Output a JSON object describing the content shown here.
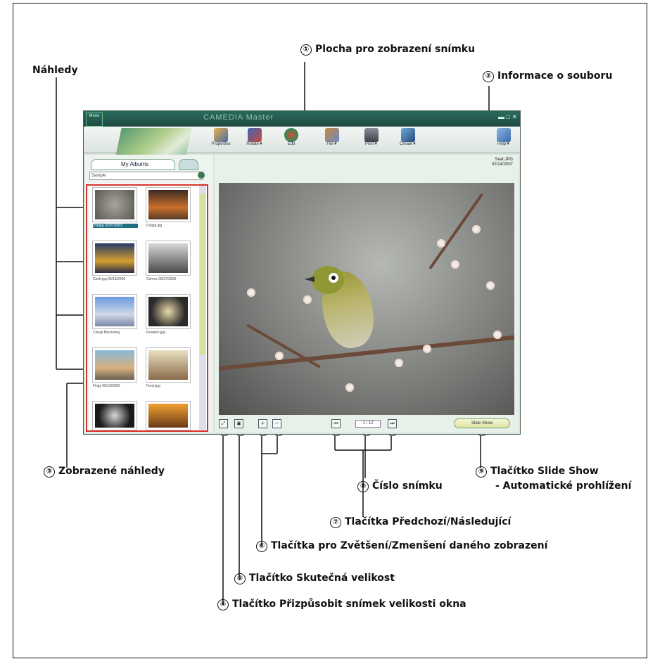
{
  "callouts": {
    "n1": "①",
    "c1": "Plocha pro zobrazení snímku",
    "n2": "②",
    "c2": "Informace o souboru",
    "nahledy": "Náhledy",
    "n3": "③",
    "c3": "Zobrazené náhledy",
    "n4": "④",
    "c4": "Tlačítko Přizpůsobit snímek velikosti okna",
    "n5": "⑤",
    "c5": "Tlačítko Skutečná velikost",
    "n6": "⑥",
    "c6": "Tlačítka pro Zvětšení/Zmenšení daného zobrazení",
    "n7": "⑦",
    "c7": "Tlačítka Předchozí/Následující",
    "n8": "⑧",
    "c8": "Číslo snímku",
    "n9": "⑨",
    "c9a": "Tlačítko Slide Show",
    "c9b": "- Automatické prohlížení"
  },
  "app": {
    "title": "CAMEDIA Master",
    "menu_tag": "Menu",
    "tools": [
      "Properties",
      "Rotate▼",
      "Edit",
      "File▼",
      "Print▼",
      "Create▼",
      "Help▼"
    ],
    "tab_label": "My Albums",
    "album_value": "Sample",
    "thumbs": [
      {
        "caption": "Dvbjpg 02/07/2003"
      },
      {
        "caption": "Dubjpj.jpg"
      },
      {
        "caption": "Cenk.jpg 06/13/2000"
      },
      {
        "caption": "Cervov 06/27/2000"
      },
      {
        "caption": "Chesp Benzomoj"
      },
      {
        "caption": "Flowelt.r.jpg"
      },
      {
        "caption": "Finjpj 05/10/2000"
      },
      {
        "caption": "Foror.jpg"
      },
      {
        "caption": ""
      },
      {
        "caption": ""
      }
    ],
    "fileinfo_line1": "Seat.JPG",
    "fileinfo_line2": "02/14/2007",
    "page_number": "1 / 12",
    "slideshow_label": "Slide Show",
    "fit_icon": "fit-window-icon",
    "actual_icon": "actual-size-icon"
  },
  "colors": {
    "accent_red": "#d8322d",
    "title_bar": "#1f4a42",
    "selection": "#1f6f83"
  }
}
